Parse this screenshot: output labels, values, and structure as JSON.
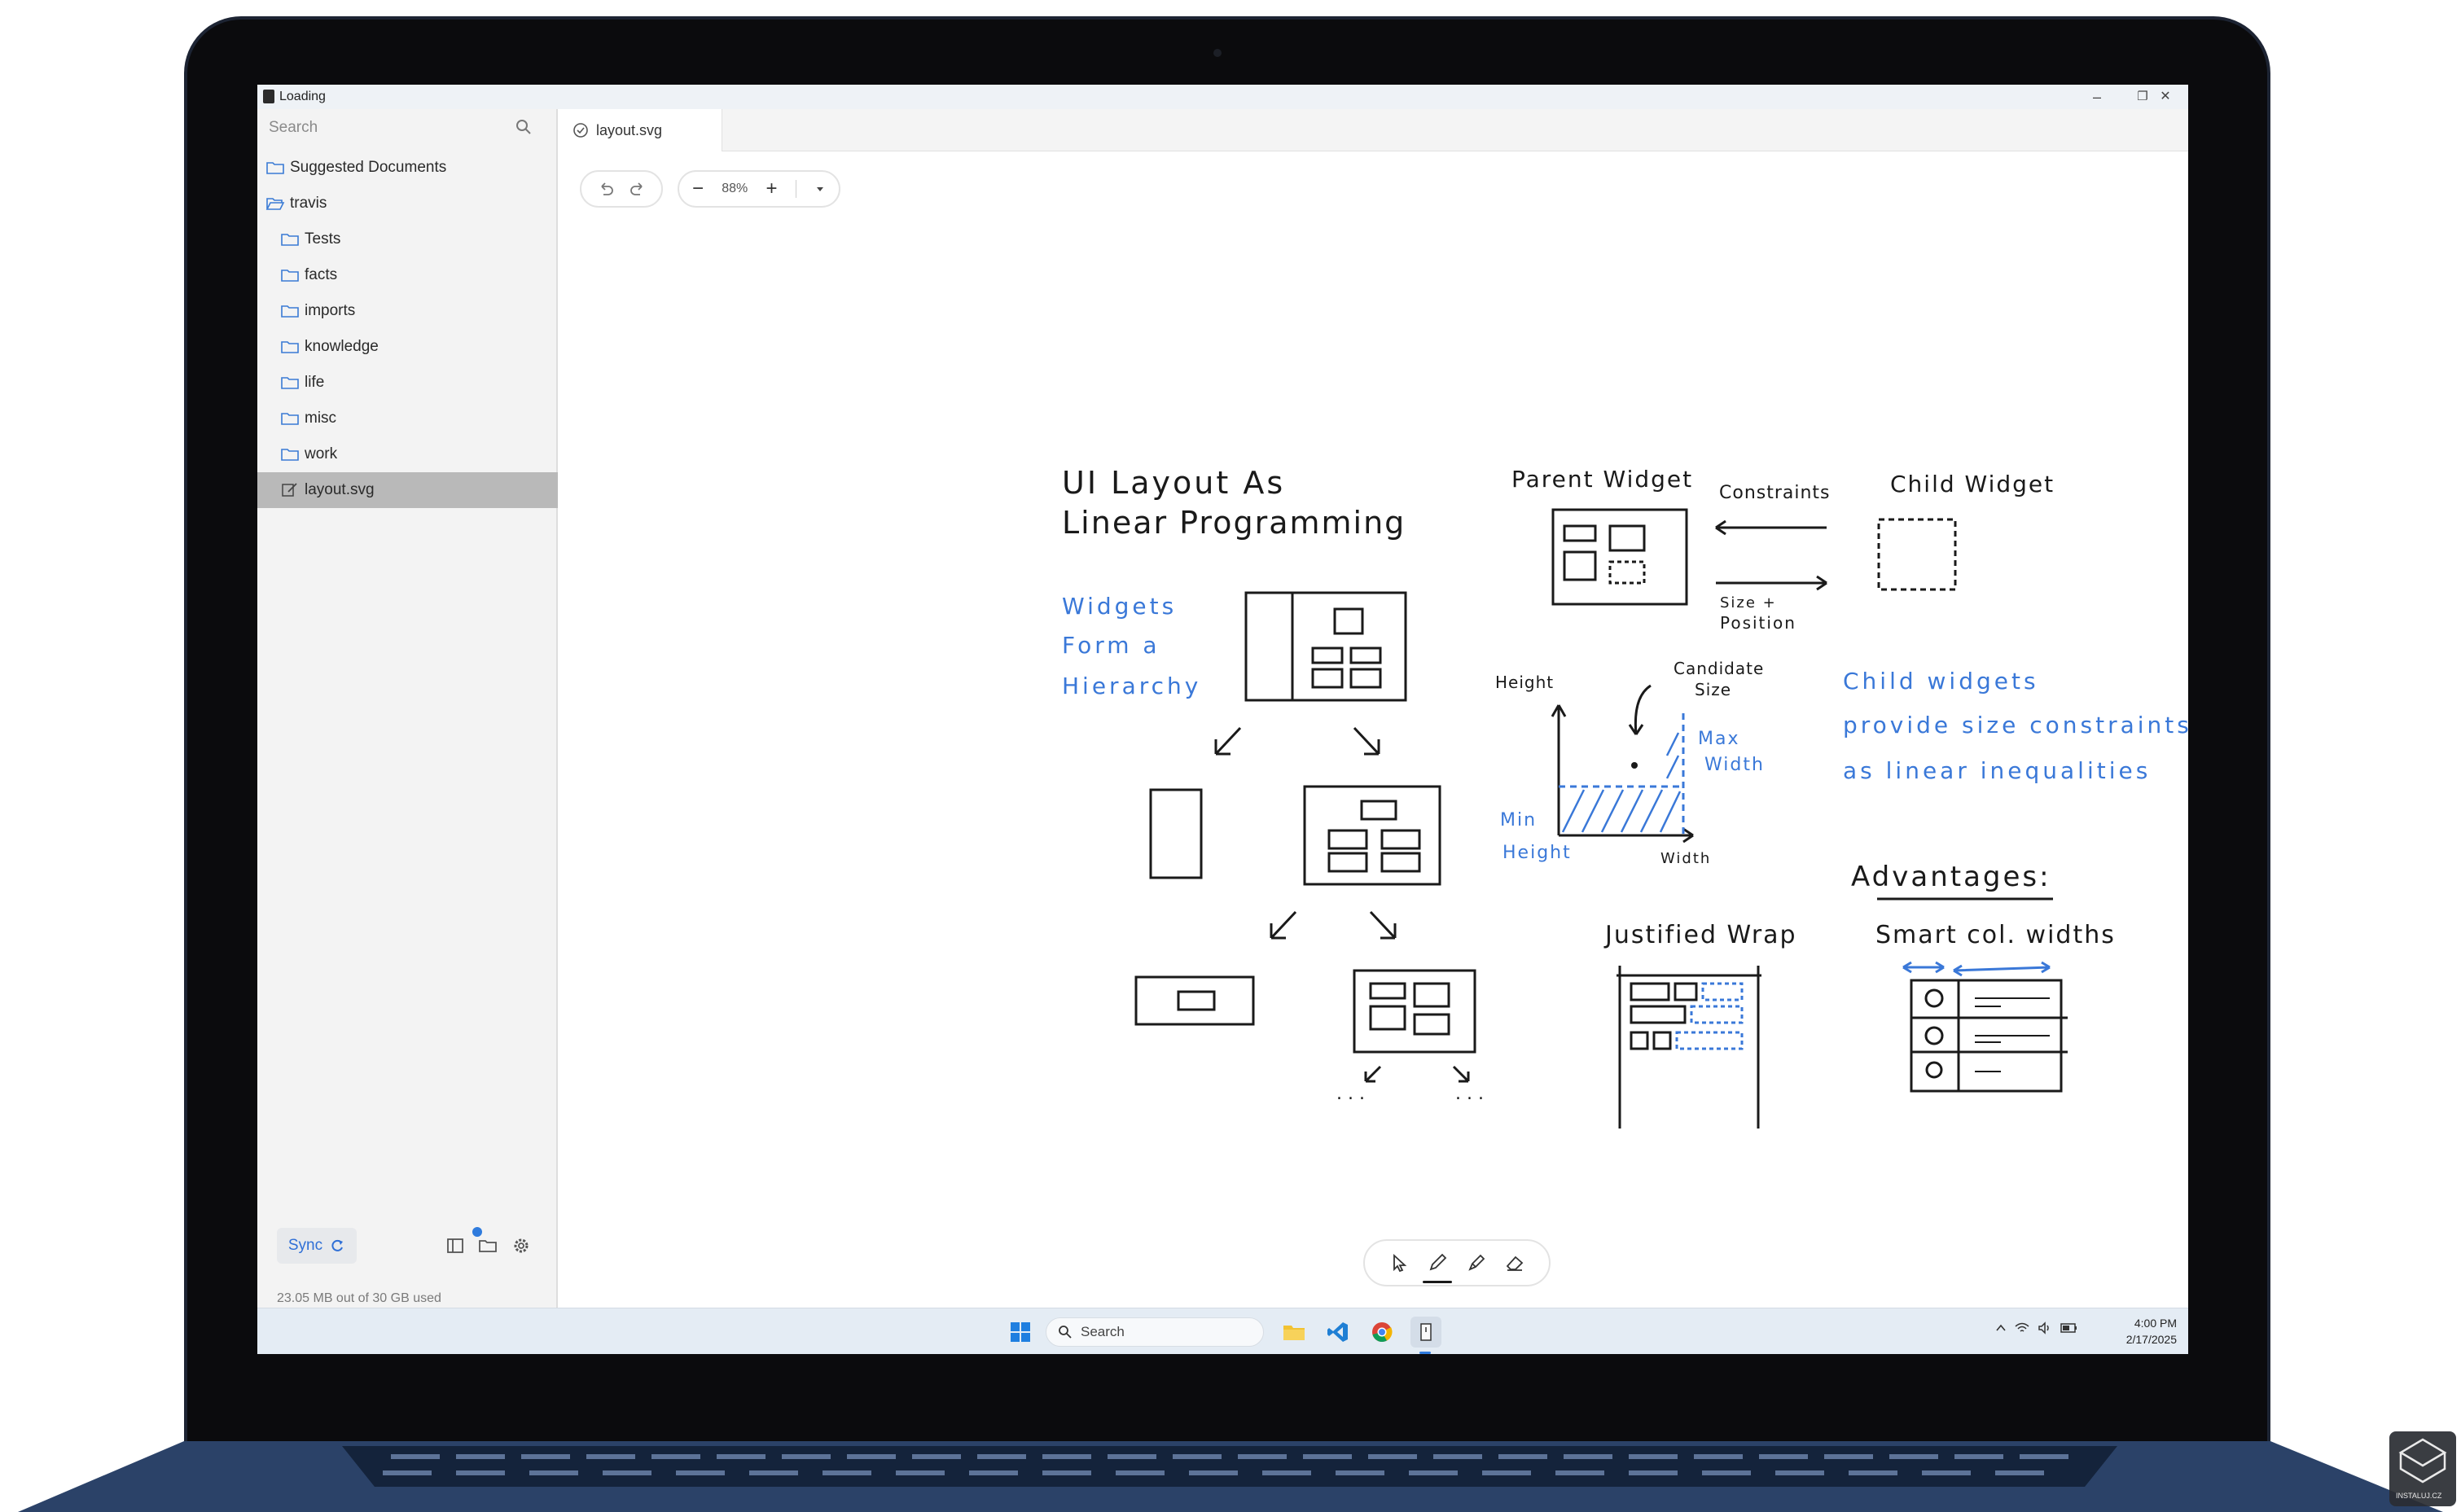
{
  "window": {
    "title": "Loading",
    "controls": {
      "minimize": "–",
      "maximize": "❐",
      "close": "✕"
    }
  },
  "sidebar": {
    "search_placeholder": "Search",
    "items": [
      {
        "label": "Suggested Documents",
        "icon": "folder-icon",
        "depth": 0
      },
      {
        "label": "travis",
        "icon": "folder-open-icon",
        "depth": 0
      },
      {
        "label": "Tests",
        "icon": "folder-icon",
        "depth": 1
      },
      {
        "label": "facts",
        "icon": "folder-icon",
        "depth": 1
      },
      {
        "label": "imports",
        "icon": "folder-icon",
        "depth": 1
      },
      {
        "label": "knowledge",
        "icon": "folder-icon",
        "depth": 1
      },
      {
        "label": "life",
        "icon": "folder-icon",
        "depth": 1
      },
      {
        "label": "misc",
        "icon": "folder-icon",
        "depth": 1
      },
      {
        "label": "work",
        "icon": "folder-icon",
        "depth": 1
      },
      {
        "label": "layout.svg",
        "icon": "drawing-file-icon",
        "depth": 1,
        "selected": true
      }
    ],
    "sync_label": "Sync",
    "storage": "23.05 MB out of 30 GB used"
  },
  "tabs": [
    {
      "label": "layout.svg",
      "icon": "check-circle-icon"
    }
  ],
  "toolbar": {
    "zoom": "88%",
    "zoom_out": "−",
    "zoom_in": "+"
  },
  "drawing": {
    "title_line1": "UI Layout As",
    "title_line2": "Linear Programming",
    "widgets_line1": "Widgets",
    "widgets_line2": "Form a",
    "widgets_line3": "Hierarchy",
    "parent_widget": "Parent Widget",
    "constraints": "Constraints",
    "child_widget": "Child Widget",
    "size_position_1": "Size +",
    "size_position_2": "Position",
    "height": "Height",
    "candidate_1": "Candidate",
    "candidate_2": "Size",
    "max_width_1": "Max",
    "max_width_2": "Width",
    "min_height_1": "Min",
    "min_height_2": "Height",
    "width": "Width",
    "child_widgets_line1": "Child widgets",
    "child_widgets_line2": "provide size constraints",
    "child_widgets_line3": "as linear inequalities",
    "advantages": "Advantages:",
    "justified_wrap": "Justified Wrap",
    "smart_col_widths": "Smart col. widths",
    "ellipsis": ". . ."
  },
  "taskbar": {
    "search_label": "Search",
    "time": "4:00 PM",
    "date": "2/17/2025"
  },
  "watermark": "INSTALUJ.CZ",
  "colors": {
    "ink": "#1a1a1a",
    "blue_ink": "#3a78d8",
    "selected_row": "#b9b9b9",
    "accent": "#2f7bdd"
  }
}
